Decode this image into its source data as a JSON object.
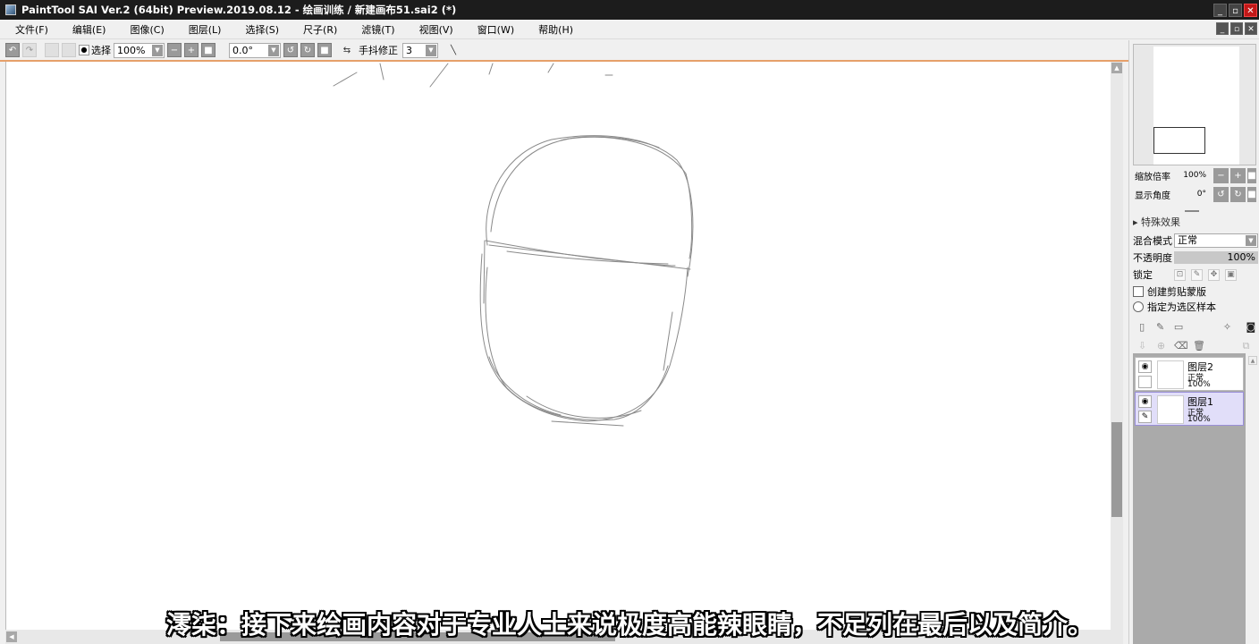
{
  "window": {
    "title": "PaintTool SAI Ver.2 (64bit) Preview.2019.08.12 - 绘画训练 / 新建画布51.sai2 (*)"
  },
  "menu": {
    "items": [
      "文件(F)",
      "编辑(E)",
      "图像(C)",
      "图层(L)",
      "选择(S)",
      "尺子(R)",
      "滤镜(T)",
      "视图(V)",
      "窗口(W)",
      "帮助(H)"
    ]
  },
  "toolbar": {
    "selection_label": "选择",
    "zoom_value": "100%",
    "angle_value": "0.0°",
    "stabilizer_label": "手抖修正",
    "stabilizer_value": "3"
  },
  "navigator": {
    "zoom_label": "缩放倍率",
    "zoom_value": "100%",
    "angle_label": "显示角度",
    "angle_value": "0°"
  },
  "layer_props": {
    "special_effects": "特殊效果",
    "blend_label": "混合模式",
    "blend_value": "正常",
    "opacity_label": "不透明度",
    "opacity_value": "100%",
    "lock_label": "锁定",
    "clipping_label": "创建剪贴蒙版",
    "selection_source_label": "指定为选区样本"
  },
  "layers": [
    {
      "name": "图层2",
      "mode": "正常",
      "opacity": "100%",
      "selected": false
    },
    {
      "name": "图层1",
      "mode": "正常",
      "opacity": "100%",
      "selected": true
    }
  ],
  "subtitle": "澪柒：接下来绘画内容对于专业人士来说极度高能辣眼睛，不足列在最后以及简介。",
  "colors": {
    "titlebar": "#1c1c1c",
    "accent_border": "#e6a06a",
    "selected_layer": "#e1def9",
    "close_button": "#c21818"
  }
}
